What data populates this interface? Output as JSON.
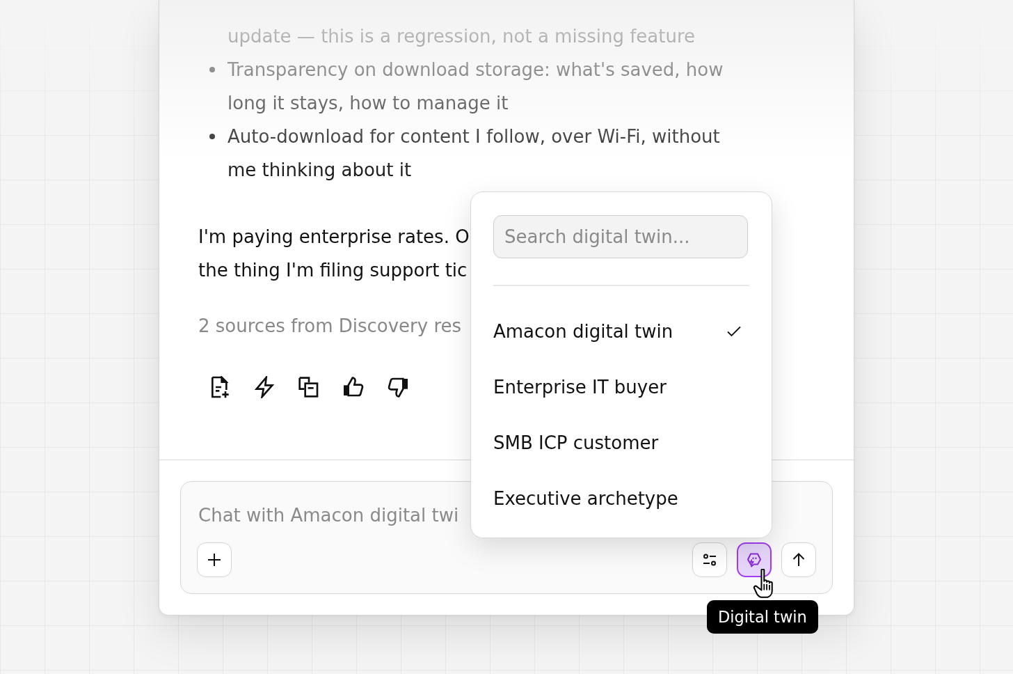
{
  "message": {
    "continued_text": "update — this is a regression, not a missing feature",
    "list_items": [
      "Transparency on download storage: what's saved, how long it stays, how to manage it",
      "Auto-download for content I follow, over Wi-Fi, without me thinking about it"
    ],
    "paragraph_lines": [
      "I'm paying enterprise rates. O",
      "the thing I'm filing support tic"
    ],
    "sources": "2 sources from Discovery res"
  },
  "composer": {
    "placeholder": "Chat with Amacon digital twi",
    "digital_twin_button": {
      "active": true
    }
  },
  "dropdown": {
    "search_placeholder": "Search digital twin...",
    "items": [
      {
        "label": "Amacon digital twin",
        "selected": true
      },
      {
        "label": "Enterprise IT buyer",
        "selected": false
      },
      {
        "label": "SMB ICP customer",
        "selected": false
      },
      {
        "label": "Executive archetype",
        "selected": false
      }
    ]
  },
  "tooltip": "Digital twin"
}
